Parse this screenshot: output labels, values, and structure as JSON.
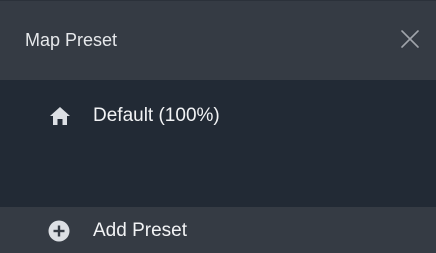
{
  "window": {
    "title": "Map Preset",
    "close_icon": "close-icon"
  },
  "presets": [
    {
      "label": "Default (100%)",
      "icon": "home-icon"
    }
  ],
  "footer": {
    "add_label": "Add Preset",
    "icon": "plus-circle-icon"
  },
  "colors": {
    "header_bg": "#353b44",
    "list_bg": "#222a35",
    "text": "#f2f3f5",
    "icon": "#dcdfe4",
    "close_icon": "#a0a4ab"
  }
}
